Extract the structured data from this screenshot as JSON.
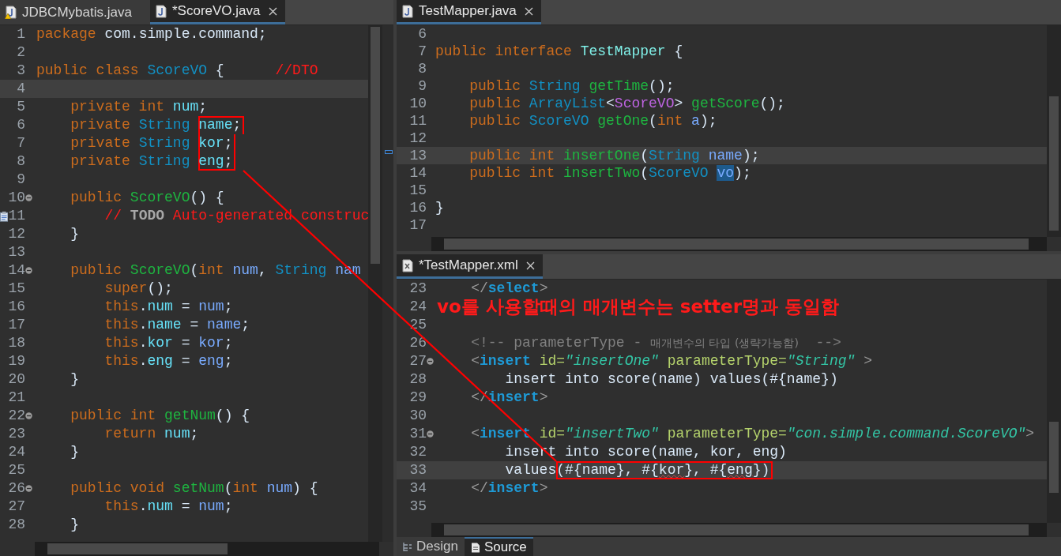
{
  "editors": [
    {
      "tabs": [
        {
          "label": "JDBCMybatis.java",
          "kind": "java",
          "warning": true,
          "selected": false
        },
        {
          "label": "*ScoreVO.java",
          "kind": "java",
          "warning": false,
          "selected": true
        }
      ],
      "lines": [
        {
          "n": "1",
          "current": false,
          "fold": false,
          "task": false,
          "tokens": [
            {
              "text": "package ",
              "kind": "kw"
            },
            {
              "text": "com.simple.command;",
              "kind": "pl"
            }
          ]
        },
        {
          "n": "2",
          "current": false,
          "fold": false,
          "task": false
        },
        {
          "n": "3",
          "current": false,
          "fold": false,
          "task": false,
          "tokens": [
            {
              "text": "public class ",
              "kind": "kw"
            },
            {
              "text": "ScoreVO",
              "kind": "type"
            },
            {
              "text": " {      ",
              "kind": "pl"
            },
            {
              "text": "//DTO",
              "kind": "cm"
            }
          ]
        },
        {
          "n": "4",
          "current": true,
          "fold": false,
          "task": false
        },
        {
          "n": "5",
          "current": false,
          "fold": false,
          "task": false,
          "tokens": [
            {
              "text": "    private int ",
              "kind": "kw"
            },
            {
              "text": "num",
              "kind": "fld"
            },
            {
              "text": ";",
              "kind": "pl"
            }
          ]
        },
        {
          "n": "6",
          "current": false,
          "fold": false,
          "task": false,
          "tokens": [
            {
              "text": "    private ",
              "kind": "kw"
            },
            {
              "text": "String ",
              "kind": "type"
            }
          ],
          "boxed_tokens": [
            {
              "text": "name",
              "kind": "fld"
            },
            {
              "text": ";",
              "kind": "pl"
            }
          ]
        },
        {
          "n": "7",
          "current": false,
          "fold": false,
          "task": false,
          "tokens": [
            {
              "text": "    private ",
              "kind": "kw"
            },
            {
              "text": "String ",
              "kind": "type"
            }
          ],
          "boxed_tokens": [
            {
              "text": "kor",
              "kind": "fld"
            },
            {
              "text": ";",
              "kind": "pl"
            }
          ]
        },
        {
          "n": "8",
          "current": false,
          "fold": false,
          "task": false,
          "tokens": [
            {
              "text": "    private ",
              "kind": "kw"
            },
            {
              "text": "String ",
              "kind": "type"
            }
          ],
          "boxed_tokens": [
            {
              "text": "eng",
              "kind": "fld"
            },
            {
              "text": ";",
              "kind": "pl"
            }
          ]
        },
        {
          "n": "9",
          "current": false,
          "fold": false,
          "task": false
        },
        {
          "n": "10",
          "current": false,
          "fold": true,
          "task": false,
          "tokens": [
            {
              "text": "    public ",
              "kind": "kw"
            },
            {
              "text": "ScoreVO",
              "kind": "fn"
            },
            {
              "text": "() {",
              "kind": "pl"
            }
          ]
        },
        {
          "n": "11",
          "current": false,
          "fold": false,
          "task": true,
          "tokens": [
            {
              "text": "        // ",
              "kind": "cm"
            },
            {
              "text": "TODO",
              "kind": "todo"
            },
            {
              "text": " Auto-generated construc",
              "kind": "cm"
            }
          ]
        },
        {
          "n": "12",
          "current": false,
          "fold": false,
          "task": false,
          "tokens": [
            {
              "text": "    }",
              "kind": "pl"
            }
          ]
        },
        {
          "n": "13",
          "current": false,
          "fold": false,
          "task": false
        },
        {
          "n": "14",
          "current": false,
          "fold": true,
          "task": false,
          "tokens": [
            {
              "text": "    public ",
              "kind": "kw"
            },
            {
              "text": "ScoreVO",
              "kind": "fn"
            },
            {
              "text": "(",
              "kind": "pl"
            },
            {
              "text": "int ",
              "kind": "kw"
            },
            {
              "text": "num",
              "kind": "par"
            },
            {
              "text": ", ",
              "kind": "pl"
            },
            {
              "text": "String ",
              "kind": "type"
            },
            {
              "text": "nam",
              "kind": "par"
            }
          ]
        },
        {
          "n": "15",
          "current": false,
          "fold": false,
          "task": false,
          "tokens": [
            {
              "text": "        super",
              "kind": "kw"
            },
            {
              "text": "();",
              "kind": "pl"
            }
          ]
        },
        {
          "n": "16",
          "current": false,
          "fold": false,
          "task": false,
          "tokens": [
            {
              "text": "        this",
              "kind": "kw"
            },
            {
              "text": ".",
              "kind": "pl"
            },
            {
              "text": "num",
              "kind": "fld"
            },
            {
              "text": " = ",
              "kind": "pl"
            },
            {
              "text": "num",
              "kind": "par"
            },
            {
              "text": ";",
              "kind": "pl"
            }
          ]
        },
        {
          "n": "17",
          "current": false,
          "fold": false,
          "task": false,
          "tokens": [
            {
              "text": "        this",
              "kind": "kw"
            },
            {
              "text": ".",
              "kind": "pl"
            },
            {
              "text": "name",
              "kind": "fld"
            },
            {
              "text": " = ",
              "kind": "pl"
            },
            {
              "text": "name",
              "kind": "par"
            },
            {
              "text": ";",
              "kind": "pl"
            }
          ]
        },
        {
          "n": "18",
          "current": false,
          "fold": false,
          "task": false,
          "tokens": [
            {
              "text": "        this",
              "kind": "kw"
            },
            {
              "text": ".",
              "kind": "pl"
            },
            {
              "text": "kor",
              "kind": "fld"
            },
            {
              "text": " = ",
              "kind": "pl"
            },
            {
              "text": "kor",
              "kind": "par"
            },
            {
              "text": ";",
              "kind": "pl"
            }
          ]
        },
        {
          "n": "19",
          "current": false,
          "fold": false,
          "task": false,
          "tokens": [
            {
              "text": "        this",
              "kind": "kw"
            },
            {
              "text": ".",
              "kind": "pl"
            },
            {
              "text": "eng",
              "kind": "fld"
            },
            {
              "text": " = ",
              "kind": "pl"
            },
            {
              "text": "eng",
              "kind": "par"
            },
            {
              "text": ";",
              "kind": "pl"
            }
          ]
        },
        {
          "n": "20",
          "current": false,
          "fold": false,
          "task": false,
          "tokens": [
            {
              "text": "    }",
              "kind": "pl"
            }
          ]
        },
        {
          "n": "21",
          "current": false,
          "fold": false,
          "task": false
        },
        {
          "n": "22",
          "current": false,
          "fold": true,
          "task": false,
          "tokens": [
            {
              "text": "    public int ",
              "kind": "kw"
            },
            {
              "text": "getNum",
              "kind": "fn"
            },
            {
              "text": "() {",
              "kind": "pl"
            }
          ]
        },
        {
          "n": "23",
          "current": false,
          "fold": false,
          "task": false,
          "tokens": [
            {
              "text": "        return ",
              "kind": "kw"
            },
            {
              "text": "num",
              "kind": "fld"
            },
            {
              "text": ";",
              "kind": "pl"
            }
          ]
        },
        {
          "n": "24",
          "current": false,
          "fold": false,
          "task": false,
          "tokens": [
            {
              "text": "    }",
              "kind": "pl"
            }
          ]
        },
        {
          "n": "25",
          "current": false,
          "fold": false,
          "task": false
        },
        {
          "n": "26",
          "current": false,
          "fold": true,
          "task": false,
          "tokens": [
            {
              "text": "    public void ",
              "kind": "kw"
            },
            {
              "text": "setNum",
              "kind": "fn"
            },
            {
              "text": "(",
              "kind": "pl"
            },
            {
              "text": "int ",
              "kind": "kw"
            },
            {
              "text": "num",
              "kind": "par"
            },
            {
              "text": ") {",
              "kind": "pl"
            }
          ]
        },
        {
          "n": "27",
          "current": false,
          "fold": false,
          "task": false,
          "tokens": [
            {
              "text": "        this",
              "kind": "kw"
            },
            {
              "text": ".",
              "kind": "pl"
            },
            {
              "text": "num",
              "kind": "fld"
            },
            {
              "text": " = ",
              "kind": "pl"
            },
            {
              "text": "num",
              "kind": "par"
            },
            {
              "text": ";",
              "kind": "pl"
            }
          ]
        },
        {
          "n": "28",
          "current": false,
          "fold": false,
          "task": false,
          "tokens": [
            {
              "text": "    }",
              "kind": "pl"
            }
          ]
        }
      ]
    },
    {
      "tabs": [
        {
          "label": "TestMapper.java",
          "kind": "java",
          "warning": false,
          "selected": true
        }
      ],
      "lines": [
        {
          "n": "6",
          "current": false,
          "fold": false,
          "task": false
        },
        {
          "n": "7",
          "current": false,
          "fold": false,
          "task": false,
          "tokens": [
            {
              "text": "public interface ",
              "kind": "kw"
            },
            {
              "text": "TestMapper",
              "kind": "cls"
            },
            {
              "text": " {",
              "kind": "pl"
            }
          ]
        },
        {
          "n": "8",
          "current": false,
          "fold": false,
          "task": false
        },
        {
          "n": "9",
          "current": false,
          "fold": false,
          "task": false,
          "tokens": [
            {
              "text": "    public ",
              "kind": "kw"
            },
            {
              "text": "String ",
              "kind": "type"
            },
            {
              "text": "getTime",
              "kind": "fn"
            },
            {
              "text": "();",
              "kind": "pl"
            }
          ]
        },
        {
          "n": "10",
          "current": false,
          "fold": false,
          "task": false,
          "tokens": [
            {
              "text": "    public ",
              "kind": "kw"
            },
            {
              "text": "ArrayList",
              "kind": "type"
            },
            {
              "text": "<",
              "kind": "pl"
            },
            {
              "text": "ScoreVO",
              "kind": "gen"
            },
            {
              "text": "> ",
              "kind": "pl"
            },
            {
              "text": "getScore",
              "kind": "fn"
            },
            {
              "text": "();",
              "kind": "pl"
            }
          ]
        },
        {
          "n": "11",
          "current": false,
          "fold": false,
          "task": false,
          "tokens": [
            {
              "text": "    public ",
              "kind": "kw"
            },
            {
              "text": "ScoreVO ",
              "kind": "type"
            },
            {
              "text": "getOne",
              "kind": "fn"
            },
            {
              "text": "(",
              "kind": "pl"
            },
            {
              "text": "int ",
              "kind": "kw"
            },
            {
              "text": "a",
              "kind": "par"
            },
            {
              "text": ");",
              "kind": "pl"
            }
          ]
        },
        {
          "n": "12",
          "current": false,
          "fold": false,
          "task": false
        },
        {
          "n": "13",
          "current": true,
          "fold": false,
          "task": false,
          "tokens": [
            {
              "text": "    public int ",
              "kind": "kw"
            },
            {
              "text": "insertOne",
              "kind": "fn"
            },
            {
              "text": "(",
              "kind": "pl"
            },
            {
              "text": "String ",
              "kind": "type"
            },
            {
              "text": "name",
              "kind": "par"
            },
            {
              "text": ");",
              "kind": "pl"
            }
          ]
        },
        {
          "n": "14",
          "current": false,
          "fold": false,
          "task": false,
          "tokens": [
            {
              "text": "    public int ",
              "kind": "kw"
            },
            {
              "text": "insertTwo",
              "kind": "fn"
            },
            {
              "text": "(",
              "kind": "pl"
            },
            {
              "text": "ScoreVO ",
              "kind": "type"
            },
            {
              "text": "vo",
              "kind": "sel"
            },
            {
              "text": ");",
              "kind": "pl"
            }
          ]
        },
        {
          "n": "15",
          "current": false,
          "fold": false,
          "task": false
        },
        {
          "n": "16",
          "current": false,
          "fold": false,
          "task": false,
          "tokens": [
            {
              "text": "}",
              "kind": "pl"
            }
          ]
        },
        {
          "n": "17",
          "current": false,
          "fold": false,
          "task": false
        }
      ]
    },
    {
      "tabs": [
        {
          "label": "*TestMapper.xml",
          "kind": "xml",
          "warning": false,
          "selected": true
        }
      ],
      "lines": [
        {
          "n": "23",
          "current": false,
          "fold": false,
          "task": false,
          "tokens": [
            {
              "text": "    </",
              "kind": "xb"
            },
            {
              "text": "select",
              "kind": "xt"
            },
            {
              "text": ">",
              "kind": "xb"
            }
          ]
        },
        {
          "n": "24",
          "current": false,
          "fold": false,
          "task": false,
          "note": "vo를 사용할때의 매개변수는 setter명과 동일함"
        },
        {
          "n": "25",
          "current": false,
          "fold": false,
          "task": false
        },
        {
          "n": "26",
          "current": false,
          "fold": false,
          "task": false,
          "tokens": [
            {
              "text": "    <!-- parameterType - ",
              "kind": "xc"
            },
            {
              "text": "매개변수의 타입 (생략가능함)",
              "kind": "xck"
            },
            {
              "text": "  -->",
              "kind": "xc"
            }
          ]
        },
        {
          "n": "27",
          "current": false,
          "fold": true,
          "task": false,
          "tokens": [
            {
              "text": "    <",
              "kind": "xb"
            },
            {
              "text": "insert",
              "kind": "xt"
            },
            {
              "text": " id=",
              "kind": "xa"
            },
            {
              "text": "\"insertOne\"",
              "kind": "xs"
            },
            {
              "text": " parameterType=",
              "kind": "xa"
            },
            {
              "text": "\"String\"",
              "kind": "xs"
            },
            {
              "text": " >",
              "kind": "xb"
            }
          ]
        },
        {
          "n": "28",
          "current": false,
          "fold": false,
          "task": false,
          "tokens": [
            {
              "text": "        insert into score(name) values(#{name})",
              "kind": "pl"
            }
          ]
        },
        {
          "n": "29",
          "current": false,
          "fold": false,
          "task": false,
          "tokens": [
            {
              "text": "    </",
              "kind": "xb"
            },
            {
              "text": "insert",
              "kind": "xt"
            },
            {
              "text": ">",
              "kind": "xb"
            }
          ]
        },
        {
          "n": "30",
          "current": false,
          "fold": false,
          "task": false
        },
        {
          "n": "31",
          "current": false,
          "fold": true,
          "task": false,
          "tokens": [
            {
              "text": "    <",
              "kind": "xb"
            },
            {
              "text": "insert",
              "kind": "xt"
            },
            {
              "text": " id=",
              "kind": "xa"
            },
            {
              "text": "\"insertTwo\"",
              "kind": "xs"
            },
            {
              "text": " parameterType=",
              "kind": "xa"
            },
            {
              "text": "\"con.simple.command.ScoreVO\"",
              "kind": "xs"
            },
            {
              "text": ">",
              "kind": "xb"
            }
          ]
        },
        {
          "n": "32",
          "current": false,
          "fold": false,
          "task": false,
          "tokens": [
            {
              "text": "        insert into score(name, kor, eng)",
              "kind": "pl"
            }
          ]
        },
        {
          "n": "33",
          "current": true,
          "fold": false,
          "task": false,
          "tokens": [
            {
              "text": "        values",
              "kind": "pl"
            }
          ],
          "boxed_tokens": [
            {
              "text": "(#{name}, #{",
              "kind": "pl"
            },
            {
              "text": "kor",
              "kind": "sp"
            },
            {
              "text": "}, #{",
              "kind": "pl"
            },
            {
              "text": "eng",
              "kind": "sp"
            },
            {
              "text": "})",
              "kind": "pl"
            }
          ]
        },
        {
          "n": "34",
          "current": false,
          "fold": false,
          "task": false,
          "tokens": [
            {
              "text": "    </",
              "kind": "xb"
            },
            {
              "text": "insert",
              "kind": "xt"
            },
            {
              "text": ">",
              "kind": "xb"
            }
          ]
        },
        {
          "n": "35",
          "current": false,
          "fold": false,
          "task": false
        }
      ],
      "bottom_tabs": [
        {
          "label": "Design",
          "selected": false
        },
        {
          "label": "Source",
          "selected": true
        }
      ]
    }
  ]
}
